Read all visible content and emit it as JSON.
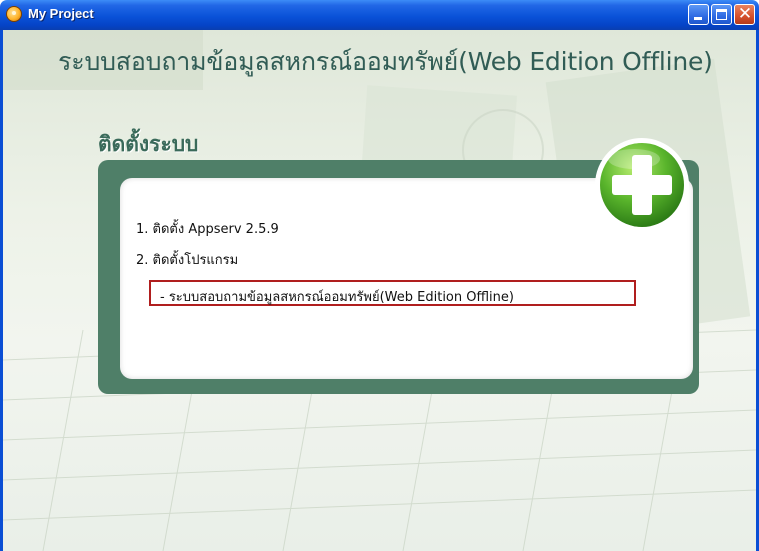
{
  "window": {
    "title": "My Project",
    "controls": {
      "minimize": "minimize",
      "maximize": "maximize",
      "close": "close"
    }
  },
  "header": {
    "title": "ระบบสอบถามข้อมูลสหกรณ์ออมทรัพย์(Web Edition Offline)"
  },
  "install": {
    "section_title": "ติดตั้งระบบ",
    "items": [
      {
        "label": "1. ติดตั้ง Appserv 2.5.9"
      },
      {
        "label": "2. ติดตั้งโปรแกรม"
      }
    ],
    "sub_items": [
      {
        "label": "- ระบบสอบถามข้อมูลสหกรณ์ออมทรัพย์(Web Edition Offline)"
      }
    ]
  },
  "icons": {
    "app": "app-orb-icon",
    "install": "plus-icon"
  },
  "colors": {
    "titlebar": "#0a52d8",
    "heading": "#315c55",
    "panel_frame": "#4f7f68",
    "highlight_border": "#b01e1e",
    "plus_green": "#5ab52c"
  }
}
